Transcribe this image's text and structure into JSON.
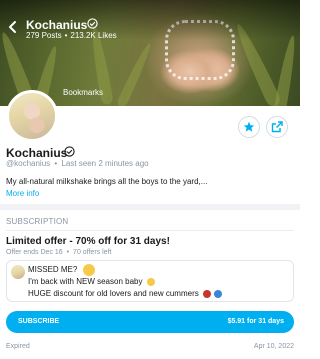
{
  "header": {
    "name": "Kochanius",
    "posts": "279 Posts",
    "likes": "213.2K Likes",
    "separator": "•",
    "bookmarks_label": "Bookmarks"
  },
  "profile": {
    "name": "Kochanius",
    "handle": "@kochanius",
    "separator": "•",
    "last_seen": "Last seen 2 minutes ago",
    "bio": "My all-natural milkshake brings all the boys to the yard,...",
    "more_info": "More info"
  },
  "subscription": {
    "section_title": "SUBSCRIPTION",
    "offer_title": "Limited offer - 70% off for 31 days!",
    "offer_ends": "Offer ends Dec 16",
    "separator": "•",
    "offers_left": "70 offers left",
    "message_lines": [
      "MISSED ME?",
      "I'm back with NEW season baby",
      "HUGE discount for old lovers and new cummers"
    ],
    "subscribe_label": "SUBSCRIBE",
    "price_label": "$5.91 for 31 days"
  },
  "footer": {
    "status": "Expired",
    "date": "Apr 10, 2022"
  },
  "colors": {
    "accent": "#00aff0",
    "muted": "#8a96a3"
  },
  "icons": [
    "back-arrow-icon",
    "verified-icon",
    "star-icon",
    "share-icon"
  ]
}
